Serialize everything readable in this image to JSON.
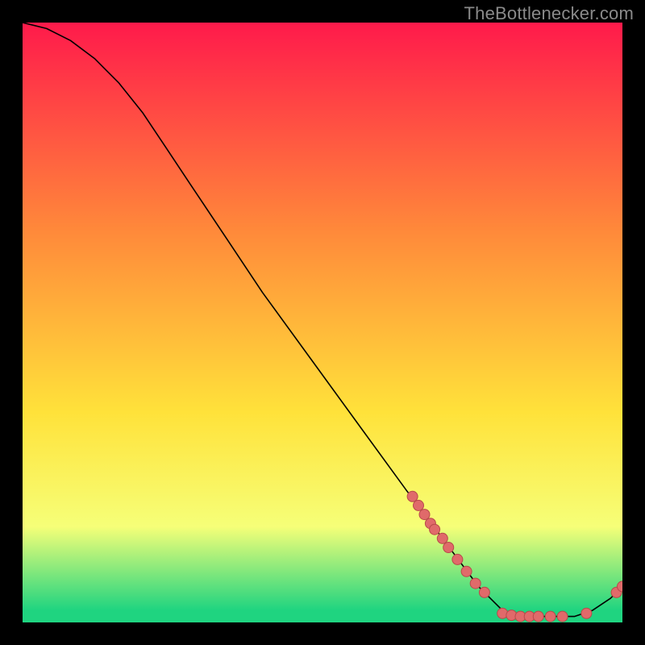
{
  "watermark": "TheBottlenecker.com",
  "chart_data": {
    "type": "line",
    "title": "",
    "xlabel": "",
    "ylabel": "",
    "xlim": [
      0,
      100
    ],
    "ylim": [
      0,
      100
    ],
    "grid": false,
    "legend": false,
    "background_gradient": {
      "top": "#ff1a4b",
      "mid1": "#ff8a3a",
      "mid2": "#ffe23a",
      "band": "#f6ff78",
      "bottom": "#1fd480"
    },
    "curve": [
      {
        "x": 0,
        "y": 100
      },
      {
        "x": 4,
        "y": 99
      },
      {
        "x": 8,
        "y": 97
      },
      {
        "x": 12,
        "y": 94
      },
      {
        "x": 16,
        "y": 90
      },
      {
        "x": 20,
        "y": 85
      },
      {
        "x": 24,
        "y": 79
      },
      {
        "x": 28,
        "y": 73
      },
      {
        "x": 34,
        "y": 64
      },
      {
        "x": 40,
        "y": 55
      },
      {
        "x": 48,
        "y": 44
      },
      {
        "x": 56,
        "y": 33
      },
      {
        "x": 64,
        "y": 22
      },
      {
        "x": 70,
        "y": 14
      },
      {
        "x": 76,
        "y": 6
      },
      {
        "x": 80,
        "y": 2
      },
      {
        "x": 84,
        "y": 1
      },
      {
        "x": 88,
        "y": 1
      },
      {
        "x": 92,
        "y": 1
      },
      {
        "x": 95,
        "y": 2
      },
      {
        "x": 98,
        "y": 4
      },
      {
        "x": 100,
        "y": 6
      }
    ],
    "markers_series_a": [
      {
        "x": 65,
        "y": 21
      },
      {
        "x": 66,
        "y": 19.5
      },
      {
        "x": 67,
        "y": 18
      },
      {
        "x": 68,
        "y": 16.5
      },
      {
        "x": 68.7,
        "y": 15.5
      },
      {
        "x": 70,
        "y": 14
      },
      {
        "x": 71,
        "y": 12.5
      },
      {
        "x": 72.5,
        "y": 10.5
      },
      {
        "x": 74,
        "y": 8.5
      },
      {
        "x": 75.5,
        "y": 6.5
      },
      {
        "x": 77,
        "y": 5
      },
      {
        "x": 80,
        "y": 1.5
      },
      {
        "x": 81.5,
        "y": 1.2
      },
      {
        "x": 83,
        "y": 1.0
      },
      {
        "x": 84.5,
        "y": 1.0
      },
      {
        "x": 86,
        "y": 1.0
      },
      {
        "x": 88,
        "y": 1.0
      },
      {
        "x": 90,
        "y": 1.0
      },
      {
        "x": 94,
        "y": 1.5
      },
      {
        "x": 99,
        "y": 5
      },
      {
        "x": 100,
        "y": 6
      }
    ],
    "marker_color": "#e06a6a",
    "marker_stroke": "#b84a4a",
    "curve_color": "#000000"
  }
}
